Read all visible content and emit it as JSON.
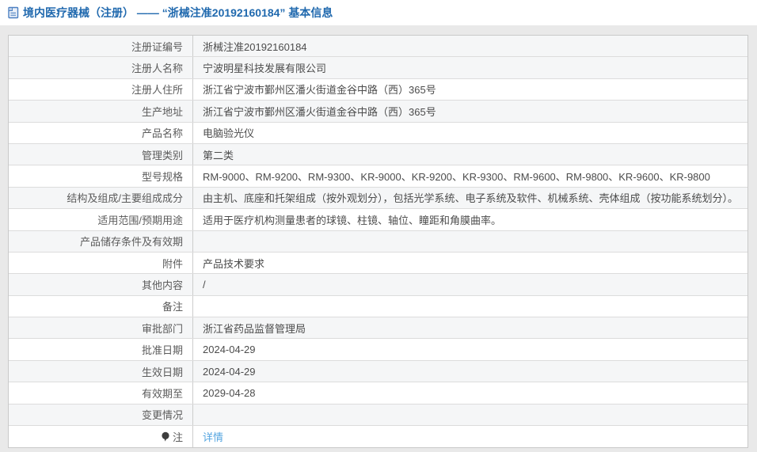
{
  "page": {
    "background_color": "#e9e9e9",
    "accent_blue": "#2069ae",
    "link_blue": "#55a5e0",
    "stripe_color": "#f5f6f7"
  },
  "header": {
    "icon": "document-icon",
    "title": "境内医疗器械（注册） —— “浙械注准20192160184” 基本信息"
  },
  "table": {
    "rows": [
      {
        "label": "注册证编号",
        "value": "浙械注准20192160184"
      },
      {
        "label": "注册人名称",
        "value": "宁波明星科技发展有限公司"
      },
      {
        "label": "注册人住所",
        "value": "浙江省宁波市鄞州区潘火街道金谷中路（西）365号"
      },
      {
        "label": "生产地址",
        "value": "浙江省宁波市鄞州区潘火街道金谷中路（西）365号"
      },
      {
        "label": "产品名称",
        "value": "电脑验光仪"
      },
      {
        "label": "管理类别",
        "value": "第二类"
      },
      {
        "label": "型号规格",
        "value": "RM-9000、RM-9200、RM-9300、KR-9000、KR-9200、KR-9300、RM-9600、RM-9800、KR-9600、KR-9800"
      },
      {
        "label": "结构及组成/主要组成成分",
        "value": "由主机、底座和托架组成（按外观划分），包括光学系统、电子系统及软件、机械系统、壳体组成（按功能系统划分）。"
      },
      {
        "label": "适用范围/预期用途",
        "value": "适用于医疗机构测量患者的球镜、柱镜、轴位、瞳距和角膜曲率。"
      },
      {
        "label": "产品储存条件及有效期",
        "value": ""
      },
      {
        "label": "附件",
        "value": "产品技术要求"
      },
      {
        "label": "其他内容",
        "value": "/"
      },
      {
        "label": "备注",
        "value": ""
      },
      {
        "label": "审批部门",
        "value": "浙江省药品监督管理局"
      },
      {
        "label": "批准日期",
        "value": "2024-04-29"
      },
      {
        "label": "生效日期",
        "value": "2024-04-29"
      },
      {
        "label": "有效期至",
        "value": "2029-04-28"
      },
      {
        "label": "变更情况",
        "value": ""
      },
      {
        "label": "注",
        "value": "详情",
        "label_icon": "note-icon",
        "value_is_link": true
      }
    ]
  }
}
